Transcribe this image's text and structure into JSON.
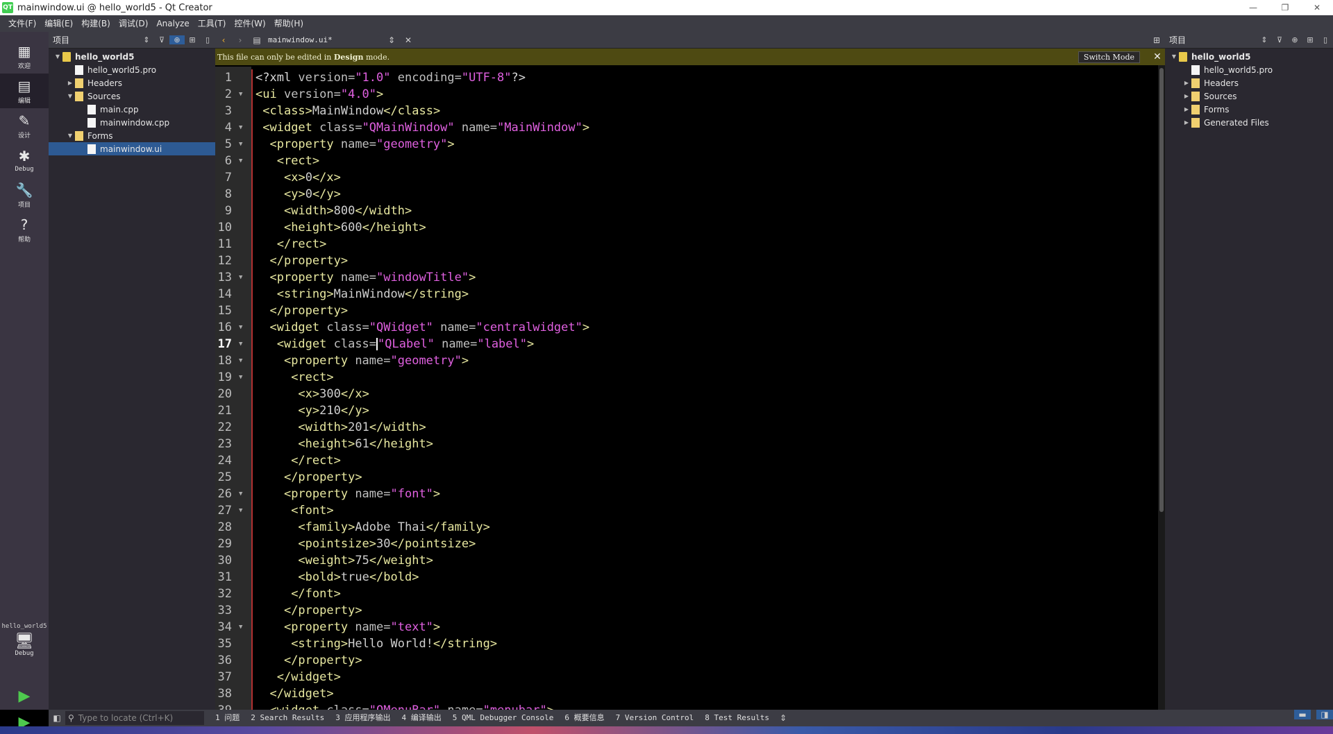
{
  "window": {
    "title": "mainwindow.ui @ hello_world5 - Qt Creator",
    "app_icon": "QT",
    "controls": {
      "minimize": "—",
      "restore": "❐",
      "close": "✕"
    }
  },
  "menu": [
    "文件(F)",
    "编辑(E)",
    "构建(B)",
    "调试(D)",
    "Analyze",
    "工具(T)",
    "控件(W)",
    "帮助(H)"
  ],
  "modes": [
    {
      "label": "欢迎",
      "icon": "grid-icon",
      "glyph": "▦"
    },
    {
      "label": "编辑",
      "icon": "edit-icon",
      "glyph": "▤",
      "active": true
    },
    {
      "label": "设计",
      "icon": "pencil-icon",
      "glyph": "✎"
    },
    {
      "label": "Debug",
      "icon": "bug-icon",
      "glyph": "✱"
    },
    {
      "label": "项目",
      "icon": "wrench-icon",
      "glyph": "🔧"
    },
    {
      "label": "帮助",
      "icon": "help-icon",
      "glyph": "?"
    }
  ],
  "kit": {
    "project": "hello_world5",
    "mode": "Debug",
    "glyph": "🖥"
  },
  "left_panel": {
    "title": "项目",
    "tree": [
      {
        "label": "hello_world5",
        "level": 0,
        "icon": "proj",
        "arrow": "▼",
        "bold": true
      },
      {
        "label": "hello_world5.pro",
        "level": 1,
        "icon": "file",
        "arrow": ""
      },
      {
        "label": "Headers",
        "level": 1,
        "icon": "folder",
        "arrow": "▶"
      },
      {
        "label": "Sources",
        "level": 1,
        "icon": "folder",
        "arrow": "▼"
      },
      {
        "label": "main.cpp",
        "level": 2,
        "icon": "file",
        "arrow": ""
      },
      {
        "label": "mainwindow.cpp",
        "level": 2,
        "icon": "file",
        "arrow": ""
      },
      {
        "label": "Forms",
        "level": 1,
        "icon": "form",
        "arrow": "▼"
      },
      {
        "label": "mainwindow.ui",
        "level": 2,
        "icon": "file",
        "arrow": "",
        "selected": true
      }
    ]
  },
  "editor": {
    "document": "mainwindow.ui*",
    "info_message_prefix": "This file can only be edited in ",
    "info_message_bold": "Design",
    "info_message_suffix": " mode.",
    "switch_mode_label": "Switch Mode",
    "current_line": 17,
    "lines": [
      "<?xml version=\"1.0\" encoding=\"UTF-8\"?>",
      "<ui version=\"4.0\">",
      " <class>MainWindow</class>",
      " <widget class=\"QMainWindow\" name=\"MainWindow\">",
      "  <property name=\"geometry\">",
      "   <rect>",
      "    <x>0</x>",
      "    <y>0</y>",
      "    <width>800</width>",
      "    <height>600</height>",
      "   </rect>",
      "  </property>",
      "  <property name=\"windowTitle\">",
      "   <string>MainWindow</string>",
      "  </property>",
      "  <widget class=\"QWidget\" name=\"centralwidget\">",
      "   <widget class=\"QLabel\" name=\"label\">",
      "    <property name=\"geometry\">",
      "     <rect>",
      "      <x>300</x>",
      "      <y>210</y>",
      "      <width>201</width>",
      "      <height>61</height>",
      "     </rect>",
      "    </property>",
      "    <property name=\"font\">",
      "     <font>",
      "      <family>Adobe Thai</family>",
      "      <pointsize>30</pointsize>",
      "      <weight>75</weight>",
      "      <bold>true</bold>",
      "     </font>",
      "    </property>",
      "    <property name=\"text\">",
      "     <string>Hello World!</string>",
      "    </property>",
      "   </widget>",
      "  </widget>",
      "  <widget class=\"QMenuBar\" name=\"menubar\">"
    ],
    "fold_lines": [
      2,
      4,
      5,
      6,
      13,
      16,
      17,
      18,
      19,
      26,
      27,
      34
    ]
  },
  "right_panel": {
    "title": "项目",
    "tree": [
      {
        "label": "hello_world5",
        "level": 0,
        "icon": "proj",
        "arrow": "▼",
        "bold": true
      },
      {
        "label": "hello_world5.pro",
        "level": 1,
        "icon": "file",
        "arrow": ""
      },
      {
        "label": "Headers",
        "level": 1,
        "icon": "folder",
        "arrow": "▶"
      },
      {
        "label": "Sources",
        "level": 1,
        "icon": "folder",
        "arrow": "▶"
      },
      {
        "label": "Forms",
        "level": 1,
        "icon": "form",
        "arrow": "▶"
      },
      {
        "label": "Generated Files",
        "level": 1,
        "icon": "folder",
        "arrow": "▶"
      }
    ]
  },
  "output": {
    "locator_placeholder": "Type to locate (Ctrl+K)",
    "tabs": [
      "1 问题",
      "2 Search Results",
      "3 应用程序输出",
      "4 编译输出",
      "5 QML Debugger Console",
      "6 概要信息",
      "7 Version Control",
      "8 Test Results"
    ]
  }
}
